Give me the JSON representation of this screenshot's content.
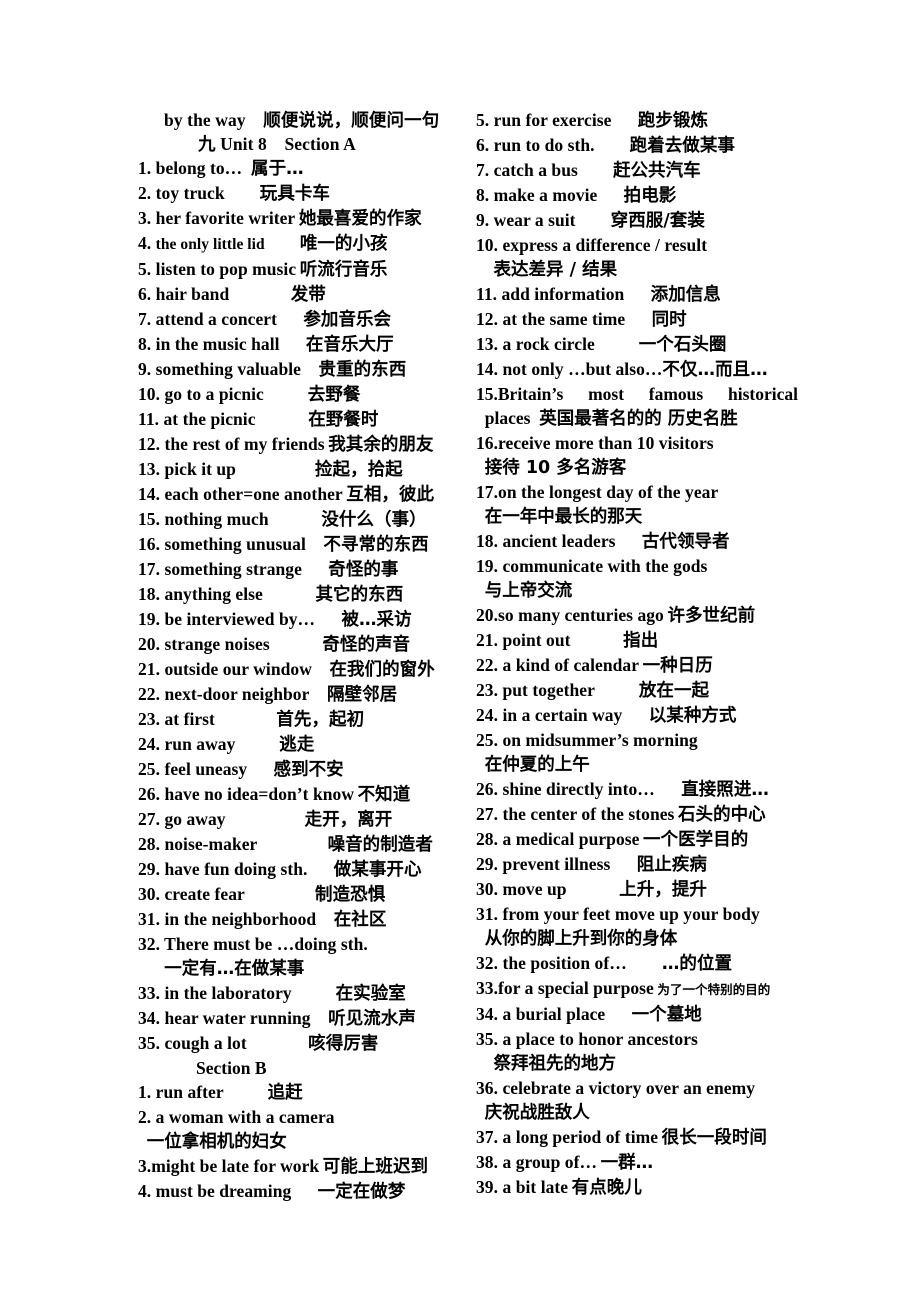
{
  "document": {
    "title_line": "by the way 顺便说说，顺便问一句",
    "unit_heading": "九 Unit 8 Section A",
    "section_b_label": "Section B"
  },
  "left_column": {
    "section_a_items": [
      {
        "num": "1.",
        "en": "belong to…",
        "gap": " ",
        "cn": "属于…"
      },
      {
        "num": "2.",
        "en": "toy truck",
        "gap": "  ",
        "cn": "玩具卡车"
      },
      {
        "num": "3.",
        "en": "her favorite writer",
        "gap": " ",
        "cn": "她最喜爱的作家"
      },
      {
        "num": "4.",
        "en": "the only little lid",
        "gap": "  ",
        "cn": "唯一的小孩",
        "small_en": true
      },
      {
        "num": "5.",
        "en": "listen to pop music",
        "gap": " ",
        "cn": "听流行音乐"
      },
      {
        "num": "6.",
        "en": "hair band",
        "gap": "    ",
        "cn": "发带"
      },
      {
        "num": "7.",
        "en": "attend a concert",
        "gap": "  ",
        "cn": "参加音乐会"
      },
      {
        "num": "8.",
        "en": "in the music hall",
        "gap": "  ",
        "cn": "在音乐大厅"
      },
      {
        "num": "9.",
        "en": "something valuable",
        "gap": " ",
        "cn": "贵重的东西"
      },
      {
        "num": "10.",
        "en": "go to a picnic",
        "gap": "   ",
        "cn": "去野餐"
      },
      {
        "num": "11.",
        "en": "at the picnic",
        "gap": "   ",
        "cn": "在野餐时"
      },
      {
        "num": "12.",
        "en": "the rest of my friends",
        "gap": " ",
        "cn": "我其余的朋友"
      },
      {
        "num": "13.",
        "en": "pick it up",
        "gap": "     ",
        "cn": "捡起，拾起"
      },
      {
        "num": "14.",
        "en": "each other=one another",
        "gap": " ",
        "cn": "互相，彼此"
      },
      {
        "num": "15.",
        "en": "nothing much",
        "gap": "   ",
        "cn": "没什么（事）"
      },
      {
        "num": "16.",
        "en": "something unusual",
        "gap": " ",
        "cn": "不寻常的东西"
      },
      {
        "num": "17.",
        "en": "something strange",
        "gap": "  ",
        "cn": "奇怪的事"
      },
      {
        "num": "18.",
        "en": "anything else",
        "gap": "   ",
        "cn": "其它的东西"
      },
      {
        "num": "19.",
        "en": "be interviewed by…",
        "gap": "  ",
        "cn": "被…采访"
      },
      {
        "num": "20.",
        "en": "strange noises",
        "gap": "   ",
        "cn": "奇怪的声音"
      },
      {
        "num": "21.",
        "en": "outside our window",
        "gap": " ",
        "cn": "在我们的窗外"
      },
      {
        "num": "22.",
        "en": "next-door neighbor",
        "gap": " ",
        "cn": "隔壁邻居"
      },
      {
        "num": "23.",
        "en": "at first",
        "gap": "    ",
        "cn": "首先，起初"
      },
      {
        "num": "24.",
        "en": "run away",
        "gap": "   ",
        "cn": "逃走"
      },
      {
        "num": "25.",
        "en": "feel uneasy",
        "gap": "  ",
        "cn": "感到不安"
      },
      {
        "num": "26.",
        "en": "have no idea=don’t know",
        "gap": " ",
        "cn": "不知道"
      },
      {
        "num": "27.",
        "en": "go away",
        "gap": "     ",
        "cn": "走开，离开"
      },
      {
        "num": "28.",
        "en": "noise-maker",
        "gap": "    ",
        "cn": "噪音的制造者"
      },
      {
        "num": "29.",
        "en": "have fun doing sth.",
        "gap": "  ",
        "cn": "做某事开心"
      },
      {
        "num": "30.",
        "en": "create fear",
        "gap": "    ",
        "cn": "制造恐惧"
      },
      {
        "num": "31.",
        "en": "in the neighborhood",
        "gap": " ",
        "cn": "在社区"
      },
      {
        "num": "32.",
        "en": "There must be …doing sth.",
        "gap": "",
        "cn": ""
      },
      {
        "cont": true,
        "cn": "一定有…在做某事",
        "indent": "  "
      },
      {
        "num": "33.",
        "en": "in the laboratory",
        "gap": "   ",
        "cn": "在实验室"
      },
      {
        "num": "34.",
        "en": "hear water running",
        "gap": " ",
        "cn": "听见流水声"
      },
      {
        "num": "35.",
        "en": "cough a lot",
        "gap": "    ",
        "cn": "咳得厉害"
      }
    ],
    "section_b_items": [
      {
        "num": "1.",
        "en": "run after",
        "gap": "   ",
        "cn": "追赶"
      },
      {
        "num": "2.",
        "en": "a woman with a camera",
        "gap": "",
        "cn": ""
      },
      {
        "cont": true,
        "cn": "一位拿相机的妇女",
        "indent": " "
      },
      {
        "num": "3.",
        "en": "might be late for work",
        "gap": " ",
        "cn": "可能上班迟到",
        "tight_num": true
      },
      {
        "num": "4.",
        "en": "must be dreaming",
        "gap": "  ",
        "cn": "一定在做梦"
      }
    ]
  },
  "right_column": {
    "items": [
      {
        "num": "5.",
        "en": "run for exercise",
        "gap": "  ",
        "cn": "跑步锻炼"
      },
      {
        "num": "6.",
        "en": "run to do sth.",
        "gap": "  ",
        "cn": "跑着去做某事"
      },
      {
        "num": "7.",
        "en": "catch a bus",
        "gap": "  ",
        "cn": "赶公共汽车"
      },
      {
        "num": "8.",
        "en": "make a movie",
        "gap": "  ",
        "cn": "拍电影"
      },
      {
        "num": "9.",
        "en": "wear a suit",
        "gap": "  ",
        "cn": "穿西服/套装"
      },
      {
        "num": "10.",
        "en": "express a difference / result",
        "gap": "",
        "cn": ""
      },
      {
        "cont": true,
        "cn": "表达差异 / 结果",
        "indent": " "
      },
      {
        "num": "11.",
        "en": "add information",
        "gap": "  ",
        "cn": "添加信息"
      },
      {
        "num": "12.",
        "en": "at the same time",
        "gap": "  ",
        "cn": "同时"
      },
      {
        "num": "13.",
        "en": "a rock circle",
        "gap": "   ",
        "cn": "一个石头圈"
      },
      {
        "num": "14.",
        "en": "not only …but also…",
        "gap": "",
        "cn": "不仅…而且…"
      },
      {
        "justified": true,
        "parts": [
          "15.Britain’s",
          "most",
          "famous",
          "historical"
        ]
      },
      {
        "cont": true,
        "mixed": true,
        "indent": " ",
        "en": "places",
        "gap": " ",
        "cn": "英国最著名的的 历史名胜"
      },
      {
        "num": "16.",
        "en": "receive more than 10 visitors",
        "gap": "",
        "cn": "",
        "tight_num": true
      },
      {
        "cont": true,
        "cn": "接待 10 多名游客",
        "indent": " "
      },
      {
        "num": "17.",
        "en": "on the longest day of the year",
        "gap": "",
        "cn": "",
        "tight_num": true
      },
      {
        "cont": true,
        "cn": "在一年中最长的那天",
        "indent": " "
      },
      {
        "num": "18.",
        "en": "ancient leaders",
        "gap": "  ",
        "cn": "古代领导者"
      },
      {
        "num": "19.",
        "en": "communicate with the gods",
        "gap": "",
        "cn": ""
      },
      {
        "cont": true,
        "cn": "与上帝交流",
        "indent": " "
      },
      {
        "num": "20.",
        "en": "so many centuries ago",
        "gap": " ",
        "cn": "许多世纪前",
        "tight_num": true
      },
      {
        "num": "21.",
        "en": "point out",
        "gap": "   ",
        "cn": "指出"
      },
      {
        "num": "22.",
        "en": "a kind of calendar",
        "gap": " ",
        "cn": "一种日历"
      },
      {
        "num": "23.",
        "en": "put together",
        "gap": "   ",
        "cn": "放在一起"
      },
      {
        "num": "24.",
        "en": "in a certain way",
        "gap": "  ",
        "cn": "以某种方式"
      },
      {
        "num": "25.",
        "en": "on midsummer’s morning",
        "gap": "",
        "cn": ""
      },
      {
        "cont": true,
        "cn": "在仲夏的上午",
        "indent": " "
      },
      {
        "num": "26.",
        "en": "shine directly into…",
        "gap": "  ",
        "cn": "直接照进…"
      },
      {
        "num": "27.",
        "en": "the center of the stones",
        "gap": " ",
        "cn": "石头的中心"
      },
      {
        "num": "28.",
        "en": "a medical purpose",
        "gap": " ",
        "cn": "一个医学目的"
      },
      {
        "num": "29.",
        "en": "prevent illness",
        "gap": "  ",
        "cn": "阻止疾病"
      },
      {
        "num": "30.",
        "en": "move up",
        "gap": "   ",
        "cn": "上升，提升"
      },
      {
        "num": "31.",
        "en": "from your feet move up your body",
        "gap": "",
        "cn": ""
      },
      {
        "cont": true,
        "cn": "从你的脚上升到你的身体",
        "indent": " "
      },
      {
        "num": "32.",
        "en": "the position of…",
        "gap": "  ",
        "cn": "…的位置"
      },
      {
        "num": "33.",
        "en": "for a special purpose",
        "gap": " ",
        "cn": "为了一个特别的目的",
        "tight_num": true,
        "cn_size": "xs"
      },
      {
        "num": "34.",
        "en": "a burial place",
        "gap": "  ",
        "cn": "一个墓地"
      },
      {
        "num": "35.",
        "en": "a place to honor ancestors",
        "gap": "",
        "cn": ""
      },
      {
        "cont": true,
        "cn": "祭拜祖先的地方",
        "indent": " "
      },
      {
        "num": "36.",
        "en": "celebrate a victory over an enemy",
        "gap": "",
        "cn": ""
      },
      {
        "cont": true,
        "cn": "庆祝战胜敌人",
        "indent": " "
      },
      {
        "num": "37.",
        "en": "a long period of time",
        "gap": " ",
        "cn": "很长一段时间"
      },
      {
        "num": "38.",
        "en": "a group of…",
        "gap": " ",
        "cn": "一群…"
      },
      {
        "num": "39.",
        "en": "a bit late",
        "gap": " ",
        "cn": "有点晚儿"
      }
    ]
  }
}
